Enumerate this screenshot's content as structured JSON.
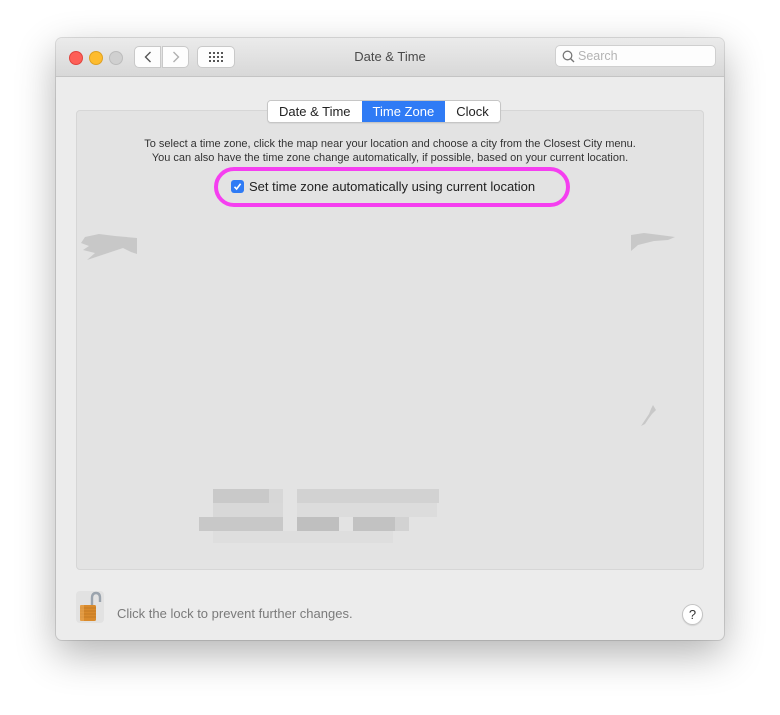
{
  "window": {
    "title": "Date & Time",
    "search_placeholder": "Search"
  },
  "tabs": [
    {
      "label": "Date & Time",
      "active": false
    },
    {
      "label": "Time Zone",
      "active": true
    },
    {
      "label": "Clock",
      "active": false
    }
  ],
  "time_zone": {
    "description_line1": "To select a time zone, click the map near your location and choose a city from the Closest City menu.",
    "description_line2": "You can also have the time zone change automatically, if possible, based on your current location.",
    "auto_checkbox_label": "Set time zone automatically using current location",
    "auto_checkbox_checked": true,
    "redacted_fields_note": "pixelated"
  },
  "footer": {
    "lock_text": "Click the lock to prevent further changes.",
    "help_label": "?"
  },
  "colors": {
    "accent": "#2f7bf5",
    "highlight": "#f53ff0",
    "close": "#fe5f57",
    "minimize": "#febc2e",
    "zoom_disabled": "#d0d0d0"
  }
}
